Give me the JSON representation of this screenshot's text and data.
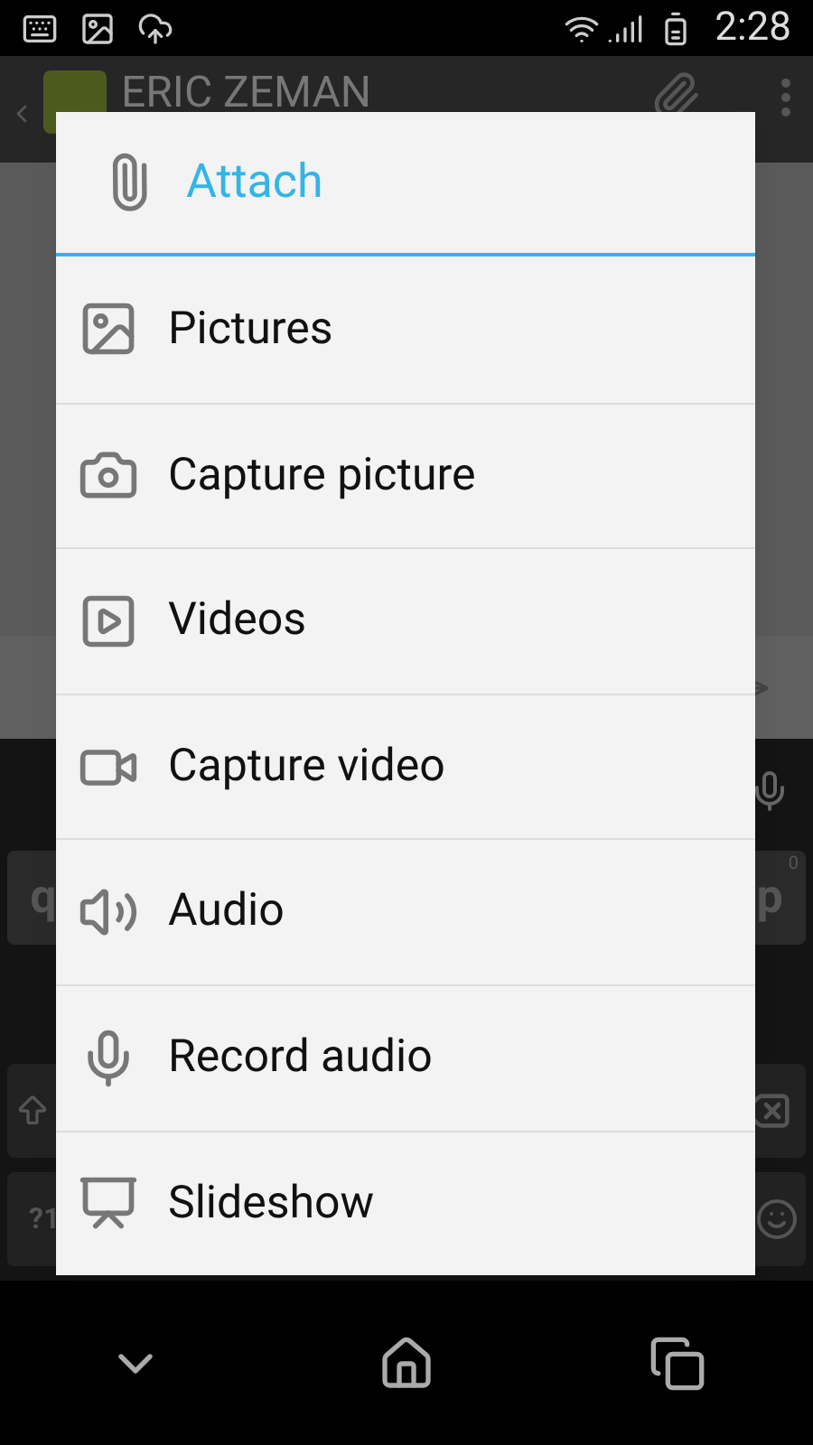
{
  "status_bar": {
    "time": "2:28"
  },
  "action_bar": {
    "title": "ERIC ZEMAN"
  },
  "keyboard": {
    "rows": [
      {
        "left": "q",
        "right": "p",
        "right_hint": "0"
      },
      {
        "left": "?1"
      }
    ]
  },
  "dialog": {
    "title": "Attach",
    "items": [
      {
        "label": "Pictures",
        "kind": "pictures"
      },
      {
        "label": "Capture picture",
        "kind": "camera"
      },
      {
        "label": "Videos",
        "kind": "videos"
      },
      {
        "label": "Capture video",
        "kind": "video_camera"
      },
      {
        "label": "Audio",
        "kind": "audio"
      },
      {
        "label": "Record audio",
        "kind": "mic"
      },
      {
        "label": "Slideshow",
        "kind": "slideshow"
      }
    ]
  }
}
